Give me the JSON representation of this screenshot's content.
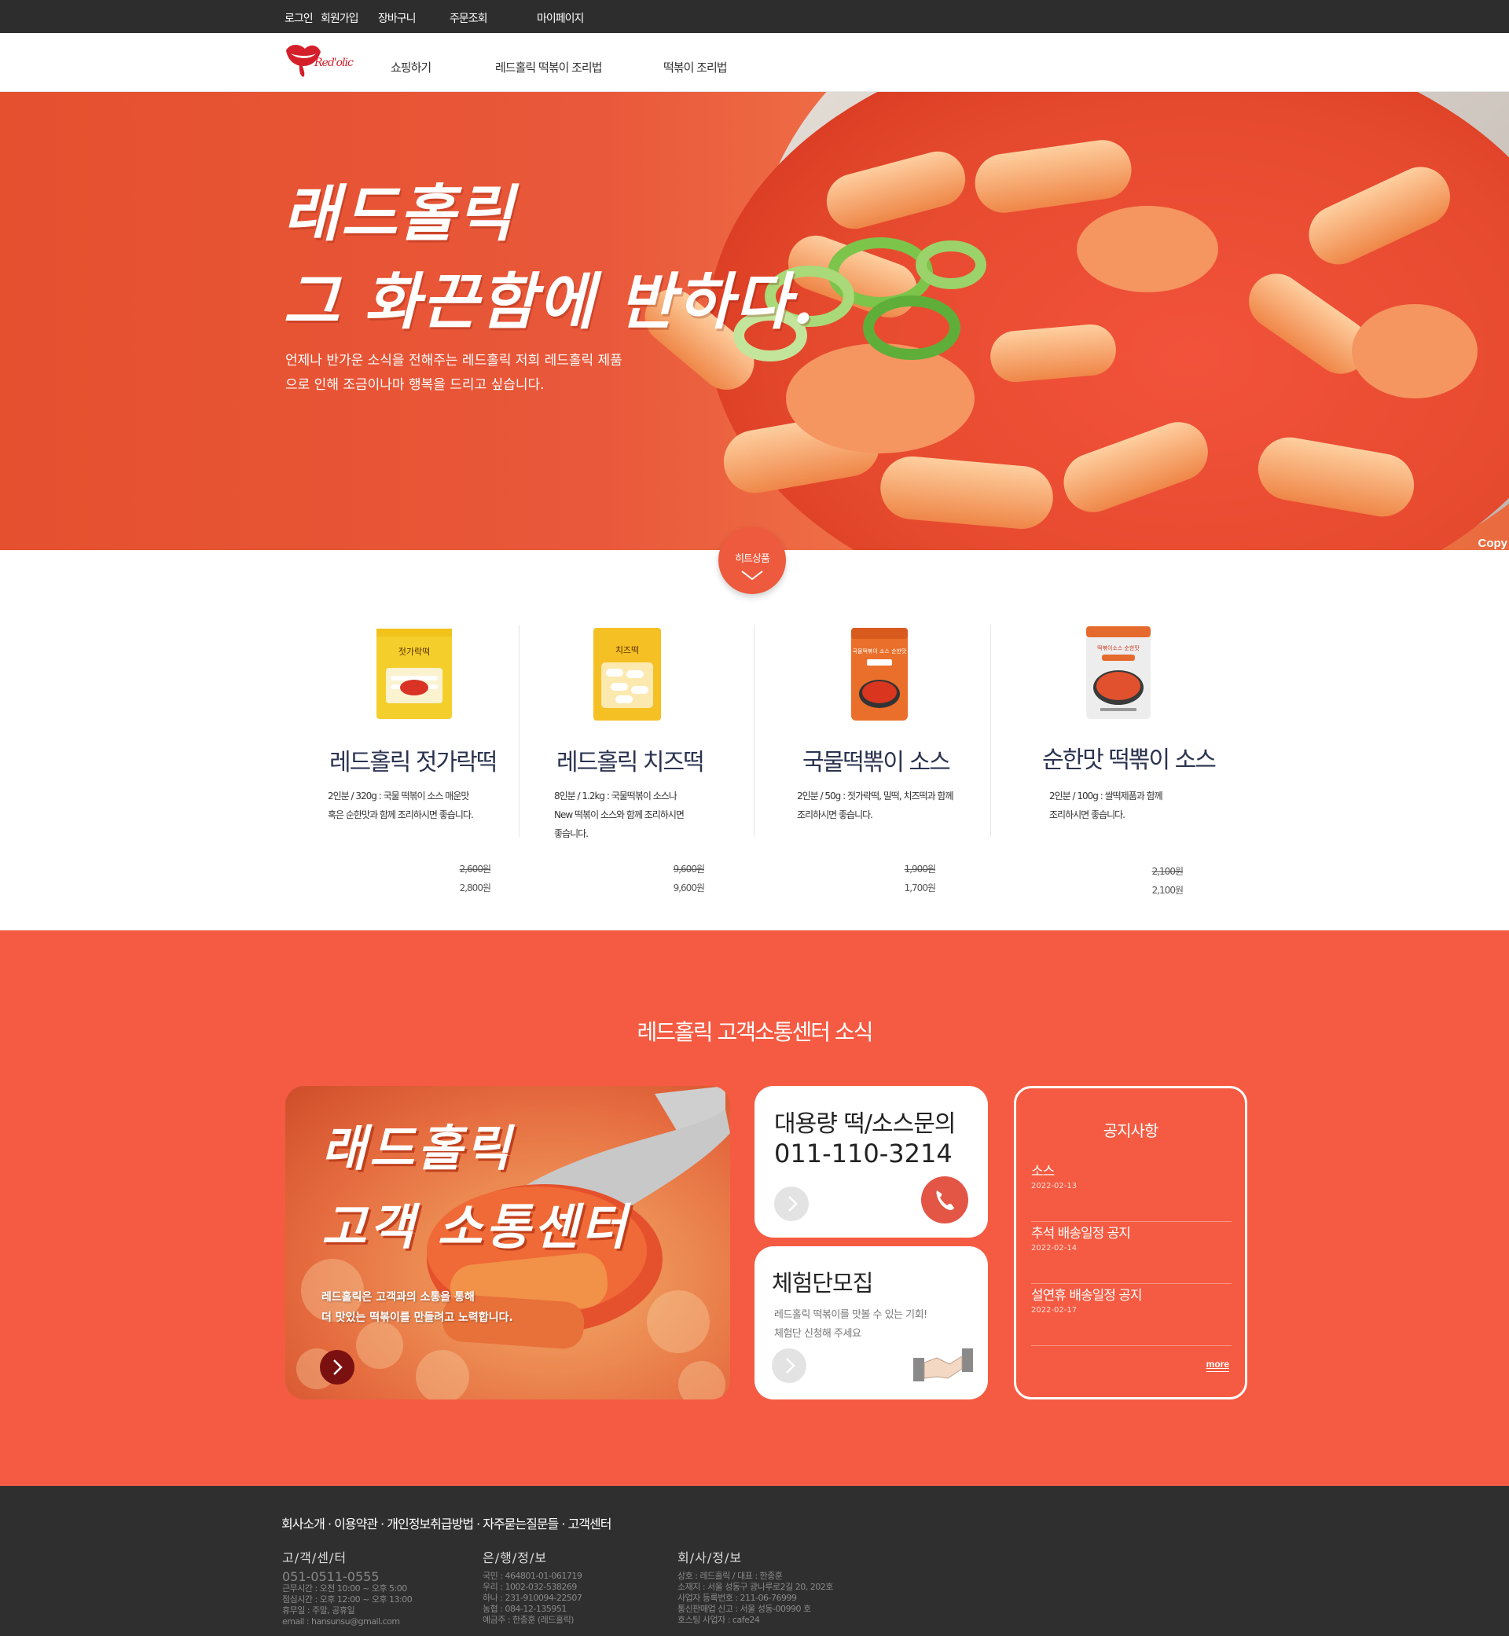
{
  "topbar": {
    "links": [
      "로그인",
      "회원가입",
      "장바구니",
      "주문조회",
      "마이페이지"
    ]
  },
  "nav": {
    "logo_text": "Red'olic",
    "items": [
      "쇼핑하기",
      "레드홀릭 떡볶이 조리법",
      "떡볶이 조리법"
    ]
  },
  "hero": {
    "title": "래드홀릭\n그 화끈함에 반하다.",
    "desc_line1": "언제나 반가운 소식을 전해주는 레드홀릭 저희 레드홀릭 제품",
    "desc_line2": "으로 인해 조금이나마 행복을 드리고 싶습니다.",
    "watermark": "Copy"
  },
  "hit_badge": {
    "label": "히트상품"
  },
  "products": [
    {
      "name": "레드홀릭 젓가락떡",
      "desc1": "2인분 / 320g : 국물 떡볶이 소스 매운맛",
      "desc2": "혹은 순한맛과 함께 조리하시면 좋습니다.",
      "desc3": "",
      "price_old": "2,600원",
      "price": "2,800원",
      "pack_label": "젓가락떡"
    },
    {
      "name": "레드홀릭 치즈떡",
      "desc1": "8인분 / 1.2kg : 국물떡볶이 소스나",
      "desc2": "New 떡볶이 소스와 함께 조리하시면",
      "desc3": "좋습니다.",
      "price_old": "9,600원",
      "price": "9,600원",
      "pack_label": "치즈떡"
    },
    {
      "name": "국물떡뽂이 소스",
      "desc1": "2인분 / 50g : 젓가락떡, 밀떡, 치즈떡과 함께",
      "desc2": "조리하시면 좋습니다.",
      "desc3": "",
      "price_old": "1,900원",
      "price": "1,700원",
      "pack_label": "국물떡볶이 소스 순한맛"
    },
    {
      "name": "순한맛 떡뽂이 소스",
      "desc1": "2인분 / 100g : 쌀떡제품과 함께",
      "desc2": "조리하시면 좋습니다.",
      "desc3": "",
      "price_old": "2,100원",
      "price": "2,100원",
      "pack_label": "떡볶이소스 순한맛"
    }
  ],
  "cs": {
    "title": "레드홀릭 고객소통센터 소식",
    "big_card": {
      "title": "래드홀릭\n고객 소통센터",
      "desc1": "레드홀릭은 고객과의 소통을 통해",
      "desc2": "더 맛있는 떡볶이를 만들려고 노력합니다."
    },
    "inquiry": {
      "title": "대용량 떡/소스문의",
      "phone": "011-110-3214"
    },
    "trial": {
      "title": "체험단모집",
      "text1": "레드홀릭 떡볶이를 맛볼 수 있는 기회!",
      "text2": "체험단 신청해 주세요"
    },
    "notice": {
      "title": "공지사항",
      "items": [
        {
          "title": "소스",
          "date": "2022-02-13"
        },
        {
          "title": "추석 배송일정 공지",
          "date": "2022-02-14"
        },
        {
          "title": "설연휴 배송일정 공지",
          "date": "2022-02-17"
        }
      ],
      "more": "more"
    }
  },
  "footer": {
    "links": "회사소개 · 이용약관 · 개인정보취급방법 · 자주묻는질문들 · 고객센터",
    "customer": {
      "title": "고/객/센/터",
      "phone": "051-0511-0555",
      "lines": [
        "근무시간 : 오전 10:00 ~ 오후 5:00",
        "점심시간 : 오후 12:00 ~ 오후 13:00",
        "휴무일 : 주말, 공휴일",
        "email : hansunsu@gmail.com"
      ]
    },
    "bank": {
      "title": "은/행/정/보",
      "lines": [
        "국민 : 464801-01-061719",
        "우리 : 1002-032-538269",
        "하나 : 231-910094-22507",
        "농협 : 084-12-135951",
        "예금주 : 한종훈 (레드홀릭)"
      ]
    },
    "company": {
      "title": "회/사/정/보",
      "lines": [
        "상호 : 레드홀릭 / 대표 : 한종훈",
        "소재지 : 서울 성동구 광나루로2길 20, 202호",
        "사업자 등록번호 : 211-06-76999",
        "통신판매업 신고 : 서울 성동-00990 호",
        "호스팅 사업자 : cafe24"
      ]
    }
  },
  "colors": {
    "accent": "#f55b42",
    "dark": "#2d2d2d",
    "phone_btn": "#e35545"
  }
}
